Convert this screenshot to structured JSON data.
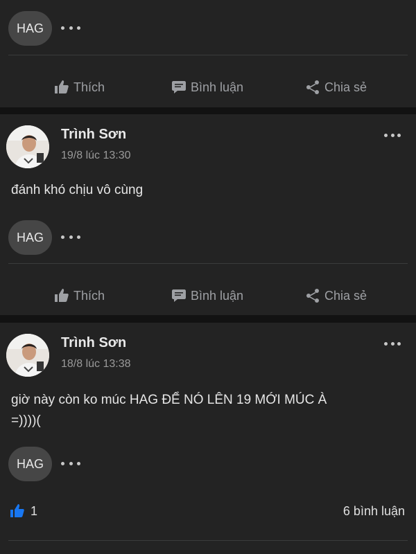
{
  "top_card": {
    "tag": "HAG",
    "actions": {
      "like": "Thích",
      "comment": "Bình luận",
      "share": "Chia sẻ"
    }
  },
  "posts": [
    {
      "author": "Trình Sơn",
      "time": "19/8 lúc 13:30",
      "text_lines": [
        "đánh khó chịu vô cùng"
      ],
      "tag": "HAG",
      "actions": {
        "like": "Thích",
        "comment": "Bình luận",
        "share": "Chia sẻ"
      }
    },
    {
      "author": "Trình Sơn",
      "time": "18/8 lúc 13:38",
      "text_lines": [
        "giờ này còn ko múc HAG ĐỂ NÓ LÊN 19 MỚI MÚC À",
        "=))))("
      ],
      "tag": "HAG",
      "like_count": "1",
      "comment_count": "6 bình luận"
    }
  ],
  "colors": {
    "accent_like": "#1877f2",
    "card_bg": "#232323",
    "page_bg": "#121212"
  }
}
